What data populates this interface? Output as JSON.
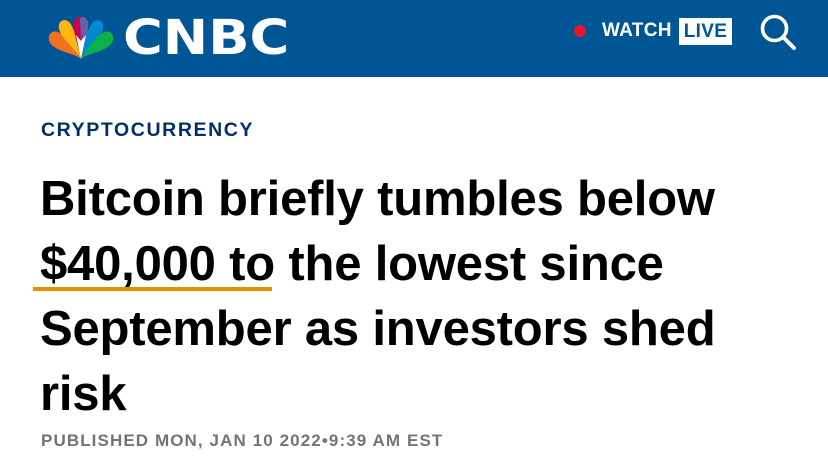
{
  "header": {
    "logo_text": "CNBC",
    "logo_icon": "peacock-icon",
    "watch_label": "WATCH",
    "live_label": "LIVE",
    "search_icon": "search-icon",
    "brand_color": "#005594",
    "live_dot_color": "#e8182a"
  },
  "article": {
    "section": "CRYPTOCURRENCY",
    "headline": {
      "line1": "Bitcoin briefly tumbles below",
      "line2_price": "$40,000",
      "line2_rest": " to the lowest since",
      "line3": "September as investors shed",
      "line4": "risk"
    },
    "underline_color": "#e88c00",
    "published_label": "PUBLISHED MON, JAN 10 2022",
    "separator": "•",
    "published_time": "9:39 AM EST"
  }
}
